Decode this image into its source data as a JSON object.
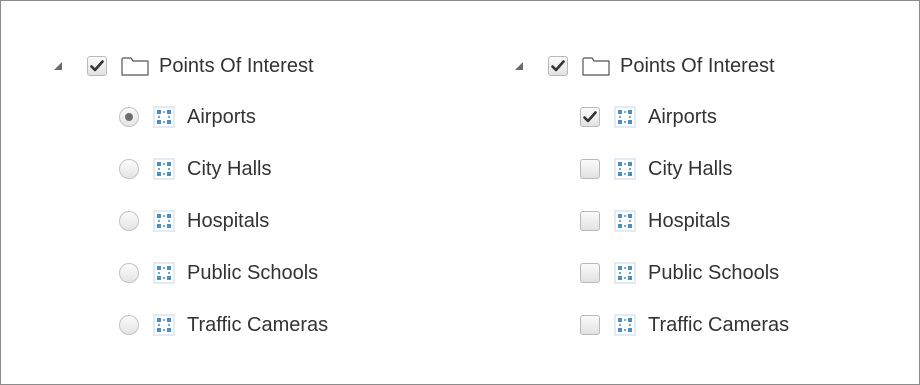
{
  "left_tree": {
    "group_label": "Points Of Interest",
    "group_checked": true,
    "selection_mode": "radio",
    "items": [
      {
        "label": "Airports",
        "checked": true
      },
      {
        "label": "City Halls",
        "checked": false
      },
      {
        "label": "Hospitals",
        "checked": false
      },
      {
        "label": "Public Schools",
        "checked": false
      },
      {
        "label": "Traffic Cameras",
        "checked": false
      }
    ]
  },
  "right_tree": {
    "group_label": "Points Of Interest",
    "group_checked": true,
    "selection_mode": "checkbox",
    "items": [
      {
        "label": "Airports",
        "checked": true
      },
      {
        "label": "City Halls",
        "checked": false
      },
      {
        "label": "Hospitals",
        "checked": false
      },
      {
        "label": "Public Schools",
        "checked": false
      },
      {
        "label": "Traffic Cameras",
        "checked": false
      }
    ]
  },
  "icons": {
    "expander": "expanded-triangle-icon",
    "group": "folder-icon",
    "item": "point-layer-icon"
  },
  "colors": {
    "text": "#333333",
    "layer_icon": "#4a90c6",
    "check_mark": "#333333",
    "radio_dot": "#6f6f6f"
  }
}
